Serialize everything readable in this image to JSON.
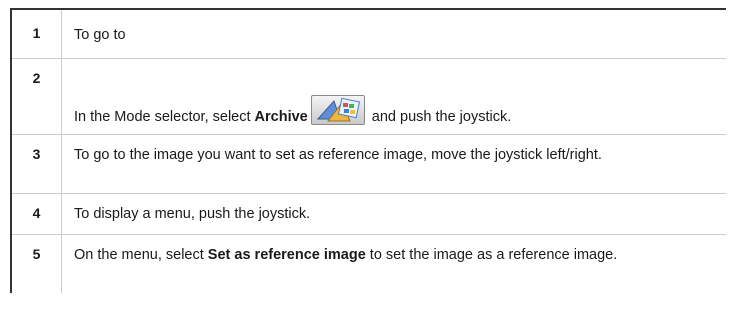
{
  "steps": [
    {
      "number": "1",
      "text": "To go to"
    },
    {
      "number": "2",
      "text_before": "In the Mode selector, select ",
      "bold_word": "Archive",
      "icon": "archive-icon",
      "text_after": " and push the joystick."
    },
    {
      "number": "3",
      "text": "To go to the image you want to set as reference image, move the joystick left/right."
    },
    {
      "number": "4",
      "text": "To display a menu, push the joystick."
    },
    {
      "number": "5",
      "text_before": "On the menu, select ",
      "bold_phrase": "Set as reference image",
      "text_after": " to set the image as a reference image."
    }
  ]
}
